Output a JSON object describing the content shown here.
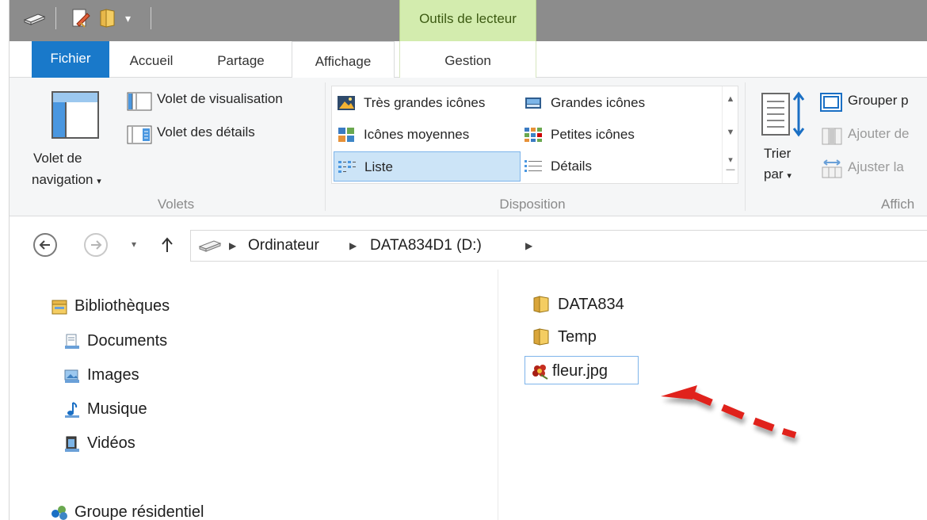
{
  "ribbon_tabs": {
    "fichier": "Fichier",
    "accueil": "Accueil",
    "partage": "Partage",
    "affichage": "Affichage",
    "gestion": "Gestion",
    "contextual": "Outils de lecteur"
  },
  "ribbon": {
    "volets": {
      "nav_pane_line1": "Volet de",
      "nav_pane_line2": "navigation",
      "preview_pane": "Volet de visualisation",
      "details_pane": "Volet des détails",
      "label": "Volets"
    },
    "disposition": {
      "label": "Disposition",
      "items": {
        "extra_large": "Très grandes icônes",
        "large": "Grandes icônes",
        "medium": "Icônes moyennes",
        "small": "Petites icônes",
        "list": "Liste",
        "details": "Détails"
      },
      "selected": "Liste"
    },
    "affichage_actuel": {
      "sort_line1": "Trier",
      "sort_line2": "par",
      "group_by": "Grouper p",
      "add_columns": "Ajouter de",
      "fit_columns": "Ajuster la",
      "label": "Affich"
    }
  },
  "address_bar": {
    "crumbs": [
      "Ordinateur",
      "DATA834D1 (D:)"
    ]
  },
  "navigation_pane": {
    "items": [
      {
        "label": "Bibliothèques",
        "icon": "libraries-icon"
      },
      {
        "label": "Documents",
        "icon": "documents-icon"
      },
      {
        "label": "Images",
        "icon": "images-icon"
      },
      {
        "label": "Musique",
        "icon": "music-icon"
      },
      {
        "label": "Vidéos",
        "icon": "videos-icon"
      },
      {
        "label": "Groupe résidentiel",
        "icon": "homegroup-icon"
      }
    ]
  },
  "files": [
    {
      "name": "DATA834",
      "type": "folder"
    },
    {
      "name": "Temp",
      "type": "folder"
    },
    {
      "name": "fleur.jpg",
      "type": "image"
    }
  ],
  "colors": {
    "file_tab": "#1979ca",
    "contextual_tab": "#d3ecae",
    "selection": "#cce4f7",
    "arrow": "#e0241c"
  }
}
